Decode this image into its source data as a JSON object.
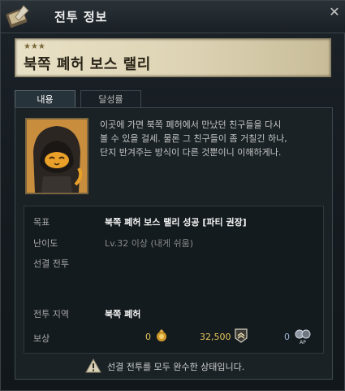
{
  "window": {
    "title": "전투 정보",
    "close_icon": "close-icon"
  },
  "quest": {
    "stars": "★★★",
    "title": "북쪽 폐허 보스 랠리"
  },
  "tabs": [
    {
      "label": "내용",
      "active": true
    },
    {
      "label": "달성률",
      "active": false
    }
  ],
  "description": {
    "lines": [
      "이곳에 가면 북쪽 폐허에서 만났던 친구들을 다시",
      "볼 수 있을 걸세. 물론 그 친구들이 좀 거칠긴 하나,",
      "단지 반겨주는 방식이 다른 것뿐이니 이해하게나."
    ]
  },
  "info": {
    "goal_label": "목표",
    "goal_value": "북쪽 폐허 보스 랠리 성공 [파티 권장]",
    "difficulty_label": "난이도",
    "difficulty_value": "Lv.32 이상 (내게 쉬움)",
    "prerequisite_label": "선결 전투",
    "prerequisite_value": "",
    "area_label": "전투 지역",
    "area_value": "북쪽 폐허",
    "reward_label": "보상",
    "reward_gold": "0",
    "reward_exp": "32,500",
    "reward_ap": "0",
    "reward_ap_tag": "AP"
  },
  "status": {
    "icon": "warning-icon",
    "text": "선결 전투를 모두 완수한 상태입니다."
  }
}
